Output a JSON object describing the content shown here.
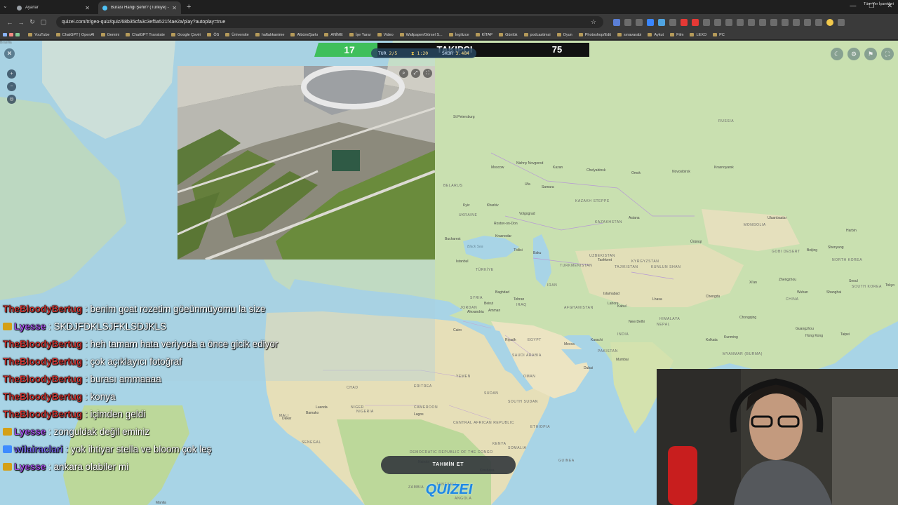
{
  "browser": {
    "tabs": [
      {
        "label": "Ayarlar",
        "active": false
      },
      {
        "label": "Burası Hangi Şehir? (Türkiye) - ...",
        "active": true
      }
    ],
    "url": "quizei.com/tr/geo-quiz/quiz/68b35cfa3c3ef5a521f4ae2a/play?autoplay=true",
    "bookmarks": [
      "YouTube",
      "ChatGPT | OpenAI",
      "Gemini",
      "ChatGPT Translate",
      "Google Çeviri",
      "ÖS",
      "Üniversite",
      "haftalıkanime",
      "Albüm/Şarkı",
      "ANİME",
      "İşe Yarar",
      "Video",
      "Wallpaper/Görsel S...",
      "İngilizce",
      "KİTAP",
      "Günlük",
      "podcastimsi",
      "Oyun",
      "Photoshop/Edit",
      "sınavarabi",
      "Aykut",
      "Film",
      "LEXO",
      "PC"
    ],
    "bookmarks_right": "Tüm Yer İşaretleri"
  },
  "follow_goal": {
    "current": "17",
    "label": "TAKIPÇI",
    "target": "75",
    "progress": 0.2267,
    "accent": "#3fbf5b"
  },
  "game": {
    "round_label": "TUR",
    "round": "2/5",
    "time": "1:20",
    "score_label": "SKOR",
    "score": "3.484"
  },
  "guess_button": "TAHMİN ET",
  "logo": "QUIZEI",
  "map_labels": [
    {
      "text": "RUSSIA",
      "kind": "country"
    },
    {
      "text": "St Petersburg",
      "kind": "city"
    },
    {
      "text": "Moscow",
      "kind": "city"
    },
    {
      "text": "Nizhny Novgorod",
      "kind": "city"
    },
    {
      "text": "Kazan",
      "kind": "city"
    },
    {
      "text": "Chelyabinsk",
      "kind": "city"
    },
    {
      "text": "Omsk",
      "kind": "city"
    },
    {
      "text": "Novosibirsk",
      "kind": "city"
    },
    {
      "text": "Krasnoyarsk",
      "kind": "city"
    },
    {
      "text": "Ufa",
      "kind": "city"
    },
    {
      "text": "Samara",
      "kind": "city"
    },
    {
      "text": "BELARUS",
      "kind": "country"
    },
    {
      "text": "Kyiv",
      "kind": "city"
    },
    {
      "text": "Kharkiv",
      "kind": "city"
    },
    {
      "text": "UKRAINE",
      "kind": "country"
    },
    {
      "text": "Volgograd",
      "kind": "city"
    },
    {
      "text": "Rostov-on-Don",
      "kind": "city"
    },
    {
      "text": "KAZAKH STEPPE",
      "kind": "country"
    },
    {
      "text": "KAZAKHSTAN",
      "kind": "country"
    },
    {
      "text": "Astana",
      "kind": "city"
    },
    {
      "text": "MONGOLIA",
      "kind": "country"
    },
    {
      "text": "Ulaanbaatar",
      "kind": "city"
    },
    {
      "text": "Harbin",
      "kind": "city"
    },
    {
      "text": "Bucharest",
      "kind": "city"
    },
    {
      "text": "Black Sea",
      "kind": "sea"
    },
    {
      "text": "Krasnodar",
      "kind": "city"
    },
    {
      "text": "Istanbul",
      "kind": "city"
    },
    {
      "text": "TÜRKİYE",
      "kind": "country"
    },
    {
      "text": "Tbilisi",
      "kind": "city"
    },
    {
      "text": "Baku",
      "kind": "city"
    },
    {
      "text": "UZBEKISTAN",
      "kind": "country"
    },
    {
      "text": "TURKMENISTAN",
      "kind": "country"
    },
    {
      "text": "KYRGYZSTAN",
      "kind": "country"
    },
    {
      "text": "TAJIKISTAN",
      "kind": "country"
    },
    {
      "text": "Tashkent",
      "kind": "city"
    },
    {
      "text": "Ürümqi",
      "kind": "city"
    },
    {
      "text": "KUNLUN SHAN",
      "kind": "country"
    },
    {
      "text": "GOBI DESERT",
      "kind": "country"
    },
    {
      "text": "Beijing",
      "kind": "city"
    },
    {
      "text": "Shenyang",
      "kind": "city"
    },
    {
      "text": "NORTH KOREA",
      "kind": "country"
    },
    {
      "text": "Seoul",
      "kind": "city"
    },
    {
      "text": "SOUTH KOREA",
      "kind": "country"
    },
    {
      "text": "Tokyo",
      "kind": "city"
    },
    {
      "text": "Xi'an",
      "kind": "city"
    },
    {
      "text": "Zhengzhou",
      "kind": "city"
    },
    {
      "text": "Wuhan",
      "kind": "city"
    },
    {
      "text": "Shanghai",
      "kind": "city"
    },
    {
      "text": "CHINA",
      "kind": "country"
    },
    {
      "text": "Chengdu",
      "kind": "city"
    },
    {
      "text": "Chongqing",
      "kind": "city"
    },
    {
      "text": "Kunming",
      "kind": "city"
    },
    {
      "text": "Taipei",
      "kind": "city"
    },
    {
      "text": "Guangzhou",
      "kind": "city"
    },
    {
      "text": "Hong Kong",
      "kind": "city"
    },
    {
      "text": "Lhasa",
      "kind": "city"
    },
    {
      "text": "HIMALAYA",
      "kind": "country"
    },
    {
      "text": "NEPAL",
      "kind": "country"
    },
    {
      "text": "New Delhi",
      "kind": "city"
    },
    {
      "text": "INDIA",
      "kind": "country"
    },
    {
      "text": "Kolkata",
      "kind": "city"
    },
    {
      "text": "MYANMAR (BURMA)",
      "kind": "country"
    },
    {
      "text": "Mumbai",
      "kind": "city"
    },
    {
      "text": "Karachi",
      "kind": "city"
    },
    {
      "text": "PAKISTAN",
      "kind": "country"
    },
    {
      "text": "Lahore",
      "kind": "city"
    },
    {
      "text": "Kabul",
      "kind": "city"
    },
    {
      "text": "Islamabad",
      "kind": "city"
    },
    {
      "text": "AFGHANISTAN",
      "kind": "country"
    },
    {
      "text": "IRAN",
      "kind": "country"
    },
    {
      "text": "Tehran",
      "kind": "city"
    },
    {
      "text": "IRAQ",
      "kind": "country"
    },
    {
      "text": "Baghdad",
      "kind": "city"
    },
    {
      "text": "SYRIA",
      "kind": "country"
    },
    {
      "text": "Beirut",
      "kind": "city"
    },
    {
      "text": "Amman",
      "kind": "city"
    },
    {
      "text": "JORDAN",
      "kind": "country"
    },
    {
      "text": "Alexandria",
      "kind": "city"
    },
    {
      "text": "Cairo",
      "kind": "city"
    },
    {
      "text": "EGYPT",
      "kind": "country"
    },
    {
      "text": "Riyadh",
      "kind": "city"
    },
    {
      "text": "SAUDI ARABIA",
      "kind": "country"
    },
    {
      "text": "Mecca",
      "kind": "city"
    },
    {
      "text": "Dubai",
      "kind": "city"
    },
    {
      "text": "OMAN",
      "kind": "country"
    },
    {
      "text": "YEMEN",
      "kind": "country"
    },
    {
      "text": "SUDAN",
      "kind": "country"
    },
    {
      "text": "ERITREA",
      "kind": "country"
    },
    {
      "text": "CHAD",
      "kind": "country"
    },
    {
      "text": "NIGER",
      "kind": "country"
    },
    {
      "text": "NIGERIA",
      "kind": "country"
    },
    {
      "text": "Lagos",
      "kind": "city"
    },
    {
      "text": "CAMEROON",
      "kind": "country"
    },
    {
      "text": "CENTRAL AFRICAN REPUBLIC",
      "kind": "country"
    },
    {
      "text": "SOUTH SUDAN",
      "kind": "country"
    },
    {
      "text": "ETHIOPIA",
      "kind": "country"
    },
    {
      "text": "SOMALIA",
      "kind": "country"
    },
    {
      "text": "KENYA",
      "kind": "country"
    },
    {
      "text": "Nairobi",
      "kind": "city"
    },
    {
      "text": "DEMOCRATIC REPUBLIC OF THE CONGO",
      "kind": "country"
    },
    {
      "text": "Kinshasa",
      "kind": "city"
    },
    {
      "text": "TANZANIA",
      "kind": "country"
    },
    {
      "text": "ANGOLA",
      "kind": "country"
    },
    {
      "text": "ZAMBIA",
      "kind": "country"
    },
    {
      "text": "Luanda",
      "kind": "city"
    },
    {
      "text": "Bamako",
      "kind": "city"
    },
    {
      "text": "MALI",
      "kind": "country"
    },
    {
      "text": "Dakar",
      "kind": "city"
    },
    {
      "text": "SENEGAL",
      "kind": "country"
    },
    {
      "text": "GUINEA",
      "kind": "country"
    },
    {
      "text": "SEYCHELLES",
      "kind": "country"
    },
    {
      "text": "Bangkok",
      "kind": "city"
    },
    {
      "text": "THAILAND",
      "kind": "country"
    },
    {
      "text": "Manila",
      "kind": "city"
    },
    {
      "text": "Brasília",
      "kind": "city"
    }
  ],
  "chat": [
    {
      "user": "TheBloodyBertug",
      "text": " : benim goat rozetim göeünmüyomu la size",
      "color": "#e53935",
      "badge": ""
    },
    {
      "user": "Lyesse",
      "text": " : SKDJFDKLSJFKLSDJKLS",
      "color": "#b45cff",
      "badge": "#d4a017"
    },
    {
      "user": "TheBloodyBertug",
      "text": " : heh tamam hata veriyoda a önce gicik ediyor",
      "color": "#e53935",
      "badge": ""
    },
    {
      "user": "TheBloodyBertug",
      "text": " : çok açıklayıcı fotoğraf",
      "color": "#e53935",
      "badge": ""
    },
    {
      "user": "TheBloodyBertug",
      "text": " : burası ammaaaa",
      "color": "#e53935",
      "badge": ""
    },
    {
      "user": "TheBloodyBertug",
      "text": " : konya",
      "color": "#e53935",
      "badge": ""
    },
    {
      "user": "TheBloodyBertug",
      "text": " : içimden geldi",
      "color": "#e53935",
      "badge": ""
    },
    {
      "user": "Lyesse",
      "text": " : zonguldak değil eminiz",
      "color": "#b45cff",
      "badge": "#d4a017"
    },
    {
      "user": "wilairaclari",
      "text": " : yok ihtiyar stella ve bloom çok leş",
      "color": "#7e6cff",
      "badge": "#3d8bff"
    },
    {
      "user": "Lyesse",
      "text": " : ankara olabiler mi",
      "color": "#b45cff",
      "badge": "#d4a017"
    }
  ],
  "icons": {
    "exit": "close-icon",
    "zoom_in": "zoom-in-icon",
    "zoom_out": "zoom-out-icon",
    "reset": "reset-icon",
    "theme": "moon-icon",
    "settings": "gear-icon",
    "report": "flag-icon",
    "fullscreen": "fullscreen-icon"
  }
}
